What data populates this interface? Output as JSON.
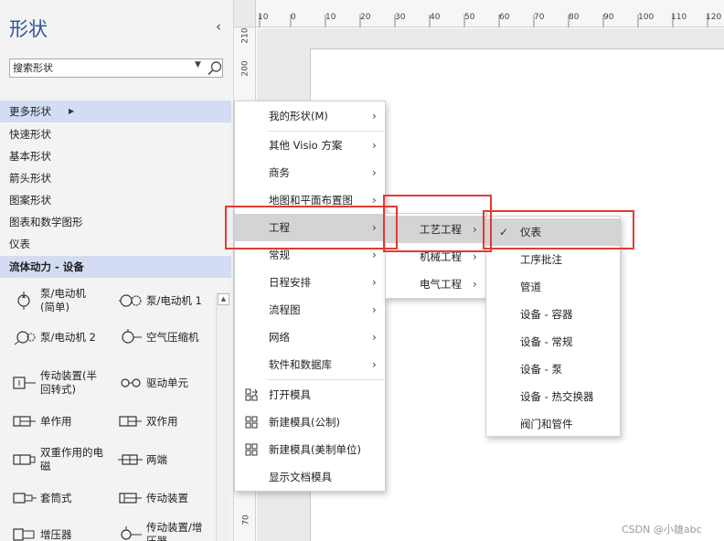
{
  "panel": {
    "title": "形状",
    "search_placeholder": "搜索形状",
    "categories": [
      {
        "label": "更多形状",
        "selected": true
      },
      {
        "label": "快速形状"
      },
      {
        "label": "基本形状"
      },
      {
        "label": "箭头形状"
      },
      {
        "label": "图案形状"
      },
      {
        "label": "图表和数学图形"
      },
      {
        "label": "仪表"
      },
      {
        "label": "流体动力 - 设备",
        "selected": true
      }
    ],
    "shapes": [
      {
        "label": "泵/电动机\n(简单)",
        "icon": "pump-simple-icon"
      },
      {
        "label": "泵/电动机 1",
        "icon": "pump-motor-icon"
      },
      {
        "label": "泵/电动机 2",
        "icon": "pump-motor-icon"
      },
      {
        "label": "空气压缩机",
        "icon": "air-compressor-icon"
      },
      {
        "label": "传动装置(半\n回转式)",
        "icon": "actuator-icon"
      },
      {
        "label": "驱动单元",
        "icon": "drive-unit-icon"
      },
      {
        "label": "单作用",
        "icon": "cylinder-icon"
      },
      {
        "label": "双作用",
        "icon": "cylinder-icon"
      },
      {
        "label": "双重作用的电\n磁",
        "icon": "solenoid-icon"
      },
      {
        "label": "两端",
        "icon": "cylinder-icon"
      },
      {
        "label": "套筒式",
        "icon": "telescopic-icon"
      },
      {
        "label": "传动装置",
        "icon": "cylinder-icon"
      },
      {
        "label": "增压器",
        "icon": "booster-icon"
      },
      {
        "label": "传动装置/增\n压器",
        "icon": "actuator-booster-icon"
      }
    ]
  },
  "ruler": {
    "top_ticks": [
      "10",
      "0",
      "10",
      "20",
      "30",
      "40",
      "50",
      "60",
      "70",
      "80",
      "90",
      "100",
      "110",
      "120"
    ],
    "left_ticks": [
      "210",
      "200",
      "70"
    ]
  },
  "menu_main": {
    "items": [
      {
        "label": "我的形状(M)",
        "submenu": true
      },
      {
        "label": "其他 Visio 方案",
        "submenu": true
      },
      {
        "label": "商务",
        "submenu": true
      },
      {
        "label": "地图和平面布置图",
        "submenu": true
      },
      {
        "label": "工程",
        "submenu": true,
        "highlighted": true
      },
      {
        "label": "常规",
        "submenu": true
      },
      {
        "label": "日程安排",
        "submenu": true
      },
      {
        "label": "流程图",
        "submenu": true
      },
      {
        "label": "网络",
        "submenu": true
      },
      {
        "label": "软件和数据库",
        "submenu": true
      },
      {
        "label": "打开模具",
        "icon": "open-stencil-icon"
      },
      {
        "label": "新建模具(公制)",
        "icon": "new-stencil-icon"
      },
      {
        "label": "新建模具(美制单位)",
        "icon": "new-stencil-icon"
      },
      {
        "label": "显示文档模具"
      }
    ]
  },
  "menu_engineering": {
    "items": [
      {
        "label": "工艺工程",
        "submenu": true,
        "highlighted": true
      },
      {
        "label": "机械工程",
        "submenu": true
      },
      {
        "label": "电气工程",
        "submenu": true
      }
    ]
  },
  "menu_process": {
    "items": [
      {
        "label": "仪表",
        "checked": true,
        "highlighted": true
      },
      {
        "label": "工序批注"
      },
      {
        "label": "管道"
      },
      {
        "label": "设备 - 容器"
      },
      {
        "label": "设备 - 常规"
      },
      {
        "label": "设备 - 泵"
      },
      {
        "label": "设备 - 热交换器"
      },
      {
        "label": "阀门和管件"
      }
    ]
  },
  "watermark": "CSDN @小雄abc",
  "colors": {
    "title_blue": "#2b579a",
    "selection_blue": "#d3dcf2",
    "menu_highlight": "#d4d4d4",
    "annotation_red": "#e53935"
  }
}
